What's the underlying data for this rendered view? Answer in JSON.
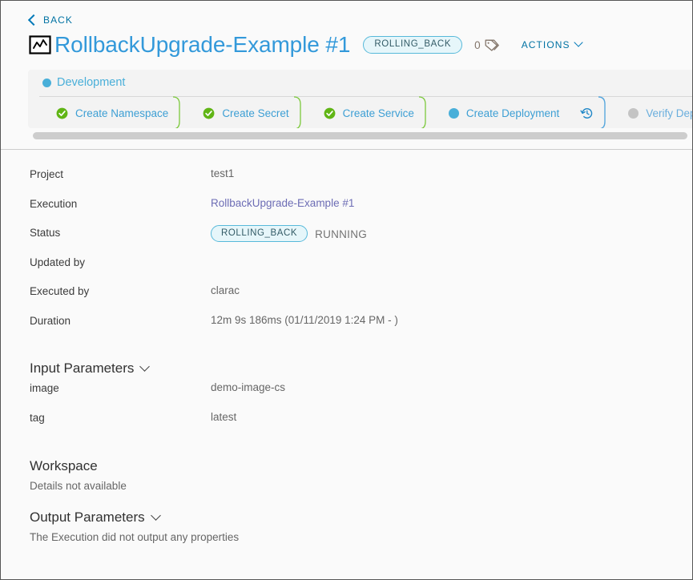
{
  "header": {
    "back_label": "BACK",
    "back_icon": "chevron-left-icon",
    "pipeline_icon": "pipeline-chart-icon",
    "title": "RollbackUpgrade-Example #1",
    "status_badge": "ROLLING_BACK",
    "tag_count": "0",
    "tag_icon": "tag-icon",
    "actions_label": "ACTIONS",
    "actions_caret_icon": "chevron-down-icon"
  },
  "stage": {
    "name": "Development",
    "status_dot": "blue",
    "tasks": [
      {
        "label": "Create Namespace",
        "icon": "check-circle-icon",
        "state": "completed",
        "separator_after": "green"
      },
      {
        "label": "Create Secret",
        "icon": "check-circle-icon",
        "state": "completed",
        "separator_after": "green"
      },
      {
        "label": "Create Service",
        "icon": "check-circle-icon",
        "state": "completed",
        "separator_after": "green"
      },
      {
        "label": "Create Deployment",
        "icon": "dot-icon",
        "state": "running",
        "action_icon": "restore-history-icon",
        "separator_after": "blue"
      },
      {
        "label": "Verify Depl",
        "icon": "dot-icon",
        "state": "pending",
        "separator_after": "none"
      }
    ]
  },
  "scrollbar": {
    "orientation": "horizontal"
  },
  "details": {
    "rows": [
      {
        "label": "Project",
        "value": "test1",
        "style": "plain"
      },
      {
        "label": "Execution",
        "value": "RollbackUpgrade-Example #1",
        "style": "link"
      },
      {
        "label": "Status",
        "badge": "ROLLING_BACK",
        "value": "RUNNING",
        "style": "badge"
      },
      {
        "label": "Updated by",
        "value": "",
        "style": "plain"
      },
      {
        "label": "Executed by",
        "value": "clarac",
        "style": "plain"
      },
      {
        "label": "Duration",
        "value": "12m 9s 186ms (01/11/2019 1:24 PM - )",
        "style": "plain"
      }
    ]
  },
  "input_parameters": {
    "title": "Input Parameters",
    "caret_icon": "chevron-down-icon",
    "rows": [
      {
        "label": "image",
        "value": "demo-image-cs"
      },
      {
        "label": "tag",
        "value": "latest"
      }
    ]
  },
  "workspace": {
    "title": "Workspace",
    "note": "Details not available"
  },
  "output_parameters": {
    "title": "Output Parameters",
    "caret_icon": "chevron-down-icon",
    "note": "The Execution did not output any properties"
  },
  "colors": {
    "accent_blue": "#49afd9",
    "link_blue": "#0072a3",
    "title_blue": "#3399da",
    "success_green": "#60b515",
    "chip_bg": "#e6f6fa",
    "chip_border": "#57b9da",
    "execution_link": "#6d6db5",
    "pending_gray": "#c4c4c4"
  }
}
